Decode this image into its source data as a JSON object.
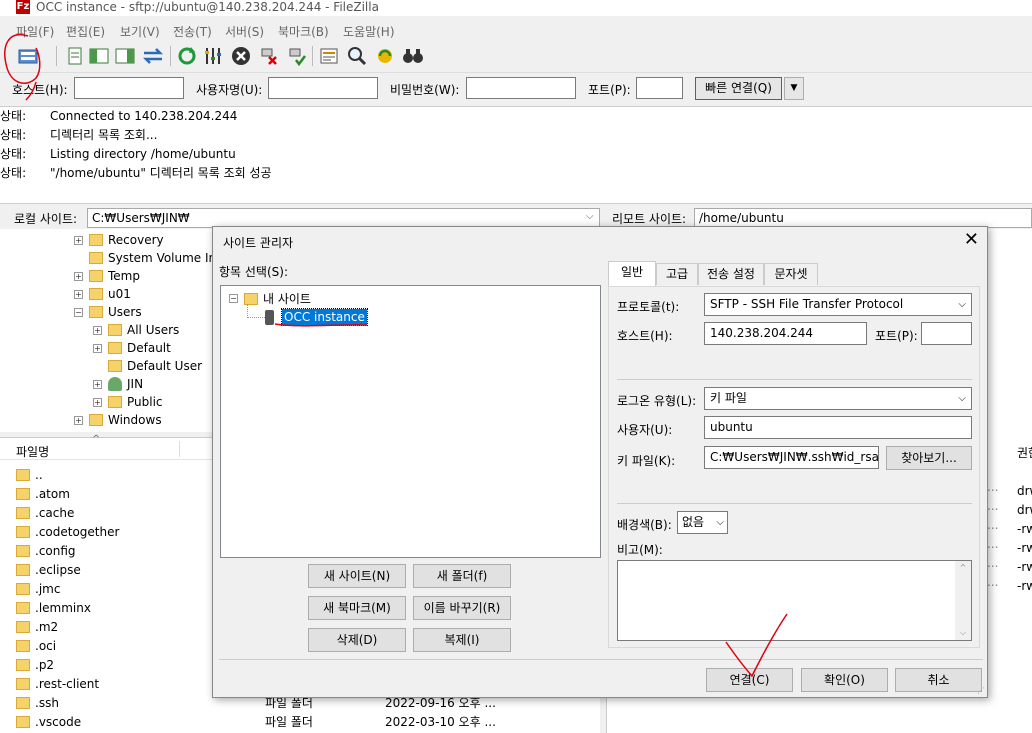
{
  "window": {
    "title": "OCC instance - sftp://ubuntu@140.238.204.244 - FileZilla",
    "logo": "Fz"
  },
  "menu": [
    "파일(F)",
    "편집(E)",
    "보기(V)",
    "전송(T)",
    "서버(S)",
    "북마크(B)",
    "도움말(H)"
  ],
  "quickconnect": {
    "host_label": "호스트(H):",
    "user_label": "사용자명(U):",
    "pass_label": "비밀번호(W):",
    "port_label": "포트(P):",
    "connect_label": "빠른 연결(Q)",
    "host_value": "",
    "user_value": "",
    "pass_value": "",
    "port_value": ""
  },
  "log": [
    {
      "key": "상태:",
      "text": "Connected to 140.238.204.244"
    },
    {
      "key": "상태:",
      "text": "디렉터리 목록 조회..."
    },
    {
      "key": "상태:",
      "text": "Listing directory /home/ubuntu"
    },
    {
      "key": "상태:",
      "text": "\"/home/ubuntu\" 디렉터리 목록 조회 성공"
    }
  ],
  "local": {
    "label": "로컬 사이트:",
    "path": "C:₩Users₩JIN₩",
    "tree": [
      "Recovery",
      "System Volume Inf",
      "Temp",
      "u01",
      "Users",
      "All Users",
      "Default",
      "Default User",
      "JIN",
      "Public",
      "Windows"
    ],
    "col_name": "파일명",
    "files": [
      {
        "name": "..",
        "type": "",
        "date": ""
      },
      {
        "name": ".atom",
        "type": "",
        "date": ""
      },
      {
        "name": ".cache",
        "type": "",
        "date": ""
      },
      {
        "name": ".codetogether",
        "type": "",
        "date": ""
      },
      {
        "name": ".config",
        "type": "",
        "date": ""
      },
      {
        "name": ".eclipse",
        "type": "",
        "date": ""
      },
      {
        "name": ".jmc",
        "type": "",
        "date": ""
      },
      {
        "name": ".lemminx",
        "type": "",
        "date": ""
      },
      {
        "name": ".m2",
        "type": "",
        "date": ""
      },
      {
        "name": ".oci",
        "type": "",
        "date": ""
      },
      {
        "name": ".p2",
        "type": "",
        "date": ""
      },
      {
        "name": ".rest-client",
        "type": "",
        "date": ""
      },
      {
        "name": ".ssh",
        "type": "파일 폴더",
        "date": "2022-09-16 오후 ..."
      },
      {
        "name": ".vscode",
        "type": "파일 폴더",
        "date": "2022-03-10 오후 ..."
      }
    ]
  },
  "remote": {
    "label": "리모트 사이트:",
    "path": "/home/ubuntu",
    "col_perm": "권한",
    "perms": [
      "drw",
      "drw",
      "-rw",
      "-rw",
      "-rw",
      "-rw"
    ]
  },
  "dialog": {
    "title": "사이트 관리자",
    "select_label": "항목 선택(S):",
    "tree_root": "내 사이트",
    "tree_item": "OCC instance",
    "buttons": {
      "new_site": "새 사이트(N)",
      "new_folder": "새 폴더(f)",
      "new_bookmark": "새 북마크(M)",
      "rename": "이름 바꾸기(R)",
      "delete": "삭제(D)",
      "duplicate": "복제(I)",
      "connect": "연결(C)",
      "ok": "확인(O)",
      "cancel": "취소"
    },
    "tabs": [
      "일반",
      "고급",
      "전송 설정",
      "문자셋"
    ],
    "general": {
      "protocol_label": "프로토콜(t):",
      "protocol_value": "SFTP - SSH File Transfer Protocol",
      "host_label": "호스트(H):",
      "host_value": "140.238.204.244",
      "port_label": "포트(P):",
      "port_value": "",
      "logon_label": "로그온 유형(L):",
      "logon_value": "키 파일",
      "user_label": "사용자(U):",
      "user_value": "ubuntu",
      "keyfile_label": "키 파일(K):",
      "keyfile_value": "C:₩Users₩JIN₩.ssh₩id_rsa",
      "browse_label": "찾아보기...",
      "bg_label": "배경색(B):",
      "bg_value": "없음",
      "comment_label": "비고(M):"
    }
  },
  "colors": {
    "annotation": "#e0000f",
    "selection": "#0078d7"
  }
}
